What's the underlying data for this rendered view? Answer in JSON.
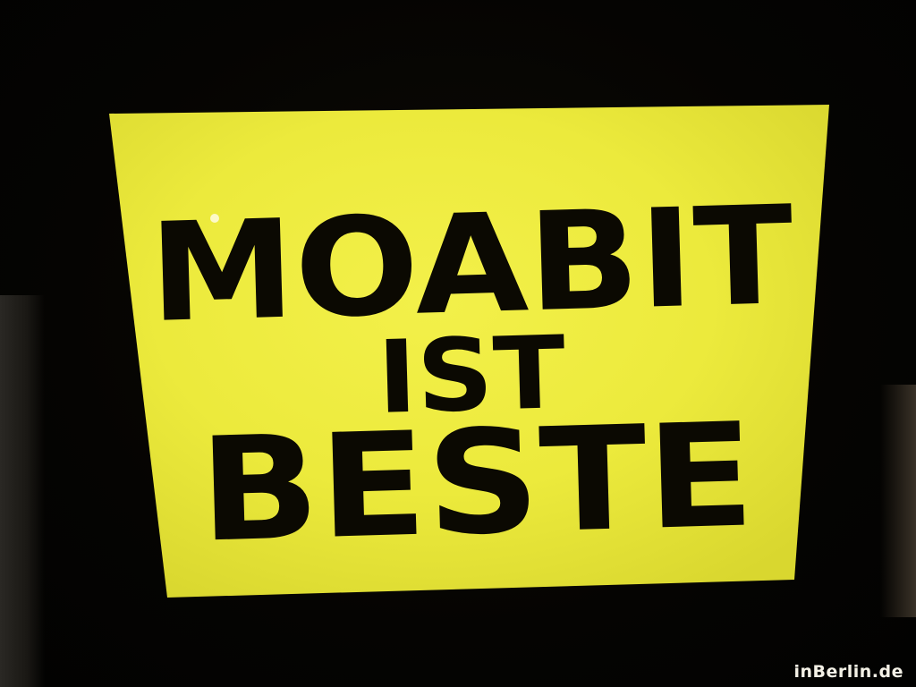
{
  "sign": {
    "line1": "MOABIT",
    "line2": "IST",
    "line3": "BESTE",
    "background_color": "#eeec3c",
    "text_color": "#0b0902"
  },
  "watermark": {
    "text": "inBerlin.de"
  }
}
